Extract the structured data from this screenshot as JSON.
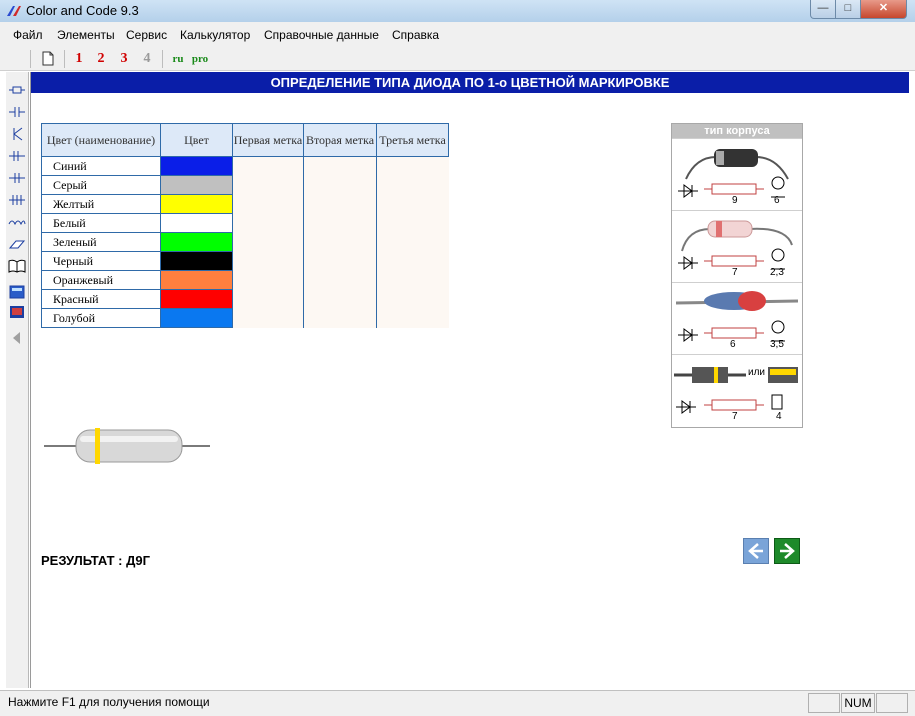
{
  "window": {
    "title": "Color and Code 9.3",
    "min": "—",
    "max": "□",
    "close": "✕"
  },
  "menu": [
    "Файл",
    "Элементы",
    "Сервис",
    "Калькулятор",
    "Справочные данные",
    "Справка"
  ],
  "toolbar": {
    "b1": "1",
    "b2": "2",
    "b3": "3",
    "b4": "4",
    "ru": "ru",
    "pro": "pro"
  },
  "header": "ОПРЕДЕЛЕНИЕ ТИПА ДИОДА ПО 1-о ЦВЕТНОЙ МАРКИРОВКЕ",
  "table": {
    "headers": [
      "Цвет (наименование)",
      "Цвет",
      "Первая метка",
      "Вторая метка",
      "Третья метка"
    ],
    "rows": [
      {
        "name": "Синий",
        "color": "#0a1ee8"
      },
      {
        "name": "Серый",
        "color": "#c0c0c0"
      },
      {
        "name": "Желтый",
        "color": "#ffff00"
      },
      {
        "name": "Белый",
        "color": "#ffffff"
      },
      {
        "name": "Зеленый",
        "color": "#00ff00"
      },
      {
        "name": "Черный",
        "color": "#000000"
      },
      {
        "name": "Оранжевый",
        "color": "#ff7f3f"
      },
      {
        "name": "Красный",
        "color": "#ff0000"
      },
      {
        "name": "Голубой",
        "color": "#0a78f0"
      }
    ]
  },
  "package": {
    "title": "тип корпуса",
    "slots": [
      {
        "len": "9",
        "dia": "6"
      },
      {
        "len": "7",
        "dia": "2,3"
      },
      {
        "len": "6",
        "dia": "3,5"
      },
      {
        "len": "7",
        "dia": "4",
        "or": "или"
      }
    ]
  },
  "result": "РЕЗУЛЬТАТ : Д9Г",
  "statusbar": {
    "text": "Нажмите F1 для получения помощи",
    "num": "NUM"
  },
  "icons": {
    "marker_color": "#ffd700",
    "header_color": "#0a1ea8"
  }
}
